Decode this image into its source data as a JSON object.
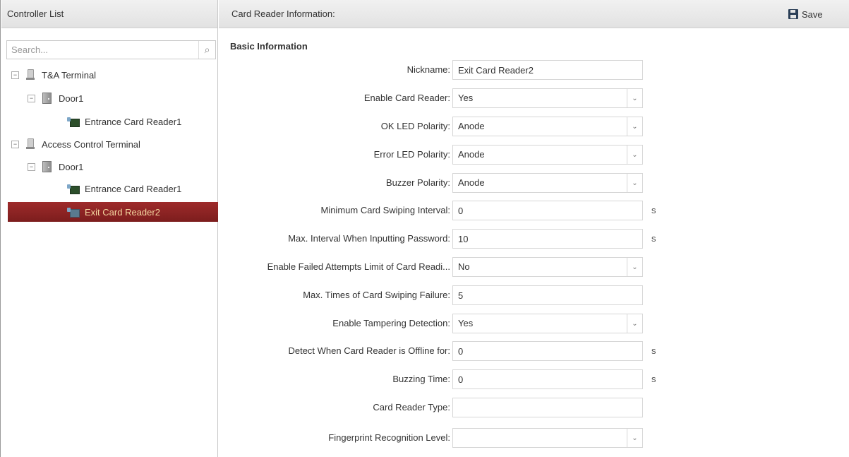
{
  "left_panel": {
    "title": "Controller List",
    "search_placeholder": "Search...",
    "tree": [
      {
        "label": "T&A Terminal",
        "toggle": "−"
      },
      {
        "label": "Door1",
        "toggle": "−"
      },
      {
        "label": "Entrance Card Reader1"
      },
      {
        "label": "Access Control Terminal",
        "toggle": "−"
      },
      {
        "label": "Door1",
        "toggle": "−"
      },
      {
        "label": "Entrance Card Reader1"
      },
      {
        "label": "Exit Card Reader2",
        "selected": true
      }
    ]
  },
  "right_panel": {
    "title": "Card Reader Information:",
    "save_label": "Save",
    "section_title": "Basic Information",
    "fields": {
      "nickname": {
        "label": "Nickname:",
        "value": "Exit Card Reader2"
      },
      "enable_card_reader": {
        "label": "Enable Card Reader:",
        "value": "Yes"
      },
      "ok_led_polarity": {
        "label": "OK LED Polarity:",
        "value": "Anode"
      },
      "error_led_polarity": {
        "label": "Error LED Polarity:",
        "value": "Anode"
      },
      "buzzer_polarity": {
        "label": "Buzzer Polarity:",
        "value": "Anode"
      },
      "min_swiping_interval": {
        "label": "Minimum Card Swiping Interval:",
        "value": "0",
        "unit": "s"
      },
      "max_interval_password": {
        "label": "Max. Interval When Inputting Password:",
        "value": "10",
        "unit": "s"
      },
      "failed_attempts_limit": {
        "label": "Enable Failed Attempts Limit of Card Readi...",
        "value": "No"
      },
      "max_swiping_failure": {
        "label": "Max. Times of Card Swiping Failure:",
        "value": "5"
      },
      "tampering_detection": {
        "label": "Enable Tampering Detection:",
        "value": "Yes"
      },
      "offline_detect": {
        "label": "Detect When Card Reader is Offline for:",
        "value": "0",
        "unit": "s"
      },
      "buzzing_time": {
        "label": "Buzzing Time:",
        "value": "0",
        "unit": "s"
      },
      "card_reader_type": {
        "label": "Card Reader Type:",
        "value": ""
      },
      "fingerprint_level": {
        "label": "Fingerprint Recognition Level:",
        "value": ""
      }
    },
    "dropdown_arrow": "⌄"
  },
  "colors": {
    "selected_bg": "#8b2424",
    "selected_text": "#f3d6a0",
    "header_bg": "#e8e8e8"
  }
}
